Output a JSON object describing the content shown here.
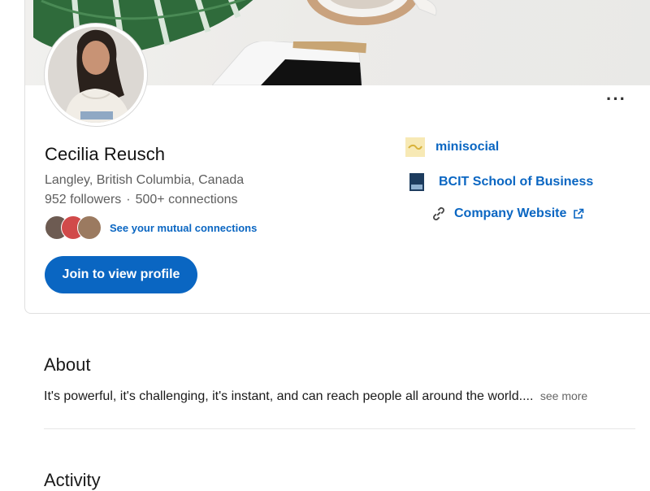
{
  "profile": {
    "name": "Cecilia Reusch",
    "location": "Langley, British Columbia, Canada",
    "followers": "952 followers",
    "separator": "·",
    "connections": "500+ connections",
    "mutual_link": "See your mutual connections",
    "join_button": "Join to view profile",
    "more_menu": "···"
  },
  "links": {
    "minisocial": "minisocial",
    "bcit": "BCIT School of Business",
    "website": "Company Website"
  },
  "about": {
    "title": "About",
    "text": "It's powerful, it's challenging, it's instant, and can reach people all around the world....",
    "see_more": "see more"
  },
  "activity": {
    "title": "Activity"
  },
  "colors": {
    "accent": "#0a66c2",
    "secondary_text": "#5e5e5e"
  },
  "icons": [
    "more-options-icon",
    "chain-link-icon",
    "external-link-icon",
    "minisocial-logo",
    "bcit-logo"
  ]
}
